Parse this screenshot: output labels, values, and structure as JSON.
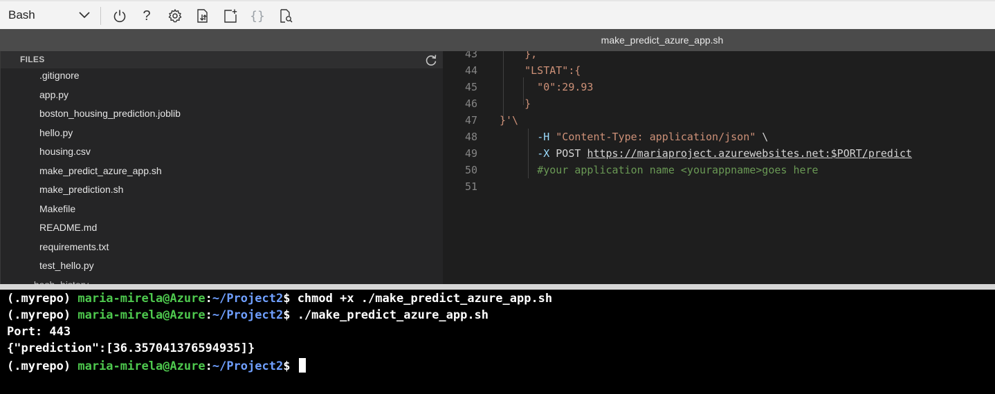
{
  "toolbar": {
    "shell": "Bash",
    "icons": [
      "restart-icon",
      "help-icon",
      "settings-icon",
      "upload-download-icon",
      "new-session-icon",
      "editor-icon",
      "web-preview-icon"
    ],
    "help_glyph": "?",
    "braces_glyph": "{}"
  },
  "editor": {
    "tab_title": "make_predict_azure_app.sh",
    "lines": [
      {
        "num": "43",
        "tokens": [
          {
            "t": "    },",
            "c": "c-str"
          }
        ]
      },
      {
        "num": "44",
        "tokens": [
          {
            "t": "    \"LSTAT\":{",
            "c": "c-str"
          }
        ]
      },
      {
        "num": "45",
        "tokens": [
          {
            "t": "      \"0\":29.93",
            "c": "c-str"
          }
        ]
      },
      {
        "num": "46",
        "tokens": [
          {
            "t": "    }",
            "c": "c-str"
          }
        ]
      },
      {
        "num": "47",
        "tokens": [
          {
            "t": "}'\\",
            "c": "c-str"
          }
        ]
      },
      {
        "num": "48",
        "tokens": [
          {
            "t": "      ",
            "c": ""
          },
          {
            "t": "-H",
            "c": "c-flag"
          },
          {
            "t": " ",
            "c": ""
          },
          {
            "t": "\"Content-Type: application/json\"",
            "c": "c-str"
          },
          {
            "t": " \\",
            "c": ""
          }
        ]
      },
      {
        "num": "49",
        "tokens": [
          {
            "t": "      ",
            "c": ""
          },
          {
            "t": "-X",
            "c": "c-flag"
          },
          {
            "t": " POST ",
            "c": ""
          },
          {
            "t": "https://mariaproject.azurewebsites.net:",
            "c": "c-url"
          },
          {
            "t": "$PORT",
            "c": "c-var c-url"
          },
          {
            "t": "/predict",
            "c": "c-url"
          }
        ]
      },
      {
        "num": "50",
        "tokens": [
          {
            "t": "      ",
            "c": ""
          },
          {
            "t": "#your application name <yourappname>goes here",
            "c": "c-cmt"
          }
        ]
      },
      {
        "num": "51",
        "tokens": []
      }
    ]
  },
  "files": {
    "title": "FILES",
    "items": [
      ".gitignore",
      "app.py",
      "boston_housing_prediction.joblib",
      "hello.py",
      "housing.csv",
      "make_predict_azure_app.sh",
      "make_prediction.sh",
      "Makefile",
      "README.md",
      "requirements.txt",
      "test_hello.py"
    ],
    "partial_item": ".bash_history"
  },
  "terminal": {
    "lines": [
      {
        "env": "(.myrepo) ",
        "user": "maria-mirela@Azure",
        "colon": ":",
        "path": "~/Project2",
        "prompt": "$ ",
        "cmd": "chmod +x ./make_predict_azure_app.sh"
      },
      {
        "env": "(.myrepo) ",
        "user": "maria-mirela@Azure",
        "colon": ":",
        "path": "~/Project2",
        "prompt": "$ ",
        "cmd": "./make_predict_azure_app.sh"
      },
      {
        "text": "Port: 443"
      },
      {
        "text": "{\"prediction\":[36.357041376594935]}"
      },
      {
        "env": "(.myrepo) ",
        "user": "maria-mirela@Azure",
        "colon": ":",
        "path": "~/Project2",
        "prompt": "$ ",
        "cmd": "",
        "cursor": true
      }
    ]
  }
}
